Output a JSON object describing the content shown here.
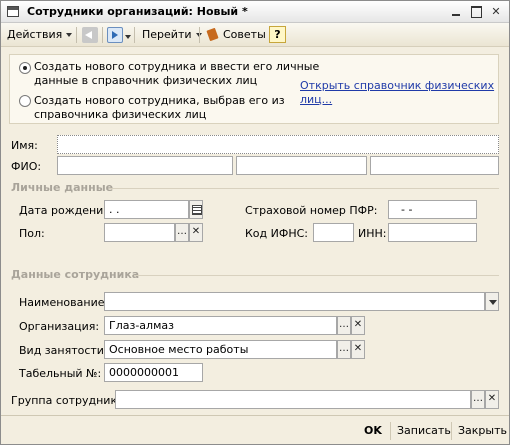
{
  "window": {
    "title": "Сотрудники организаций: Новый *"
  },
  "toolbar": {
    "actions_label": "Действия",
    "goto_label": "Перейти",
    "tips_label": "Советы",
    "help_label": "?"
  },
  "options": {
    "option1_line1": "Создать нового сотрудника и ввести его личные",
    "option1_line2": "данные в справочник физических лиц",
    "option2_line1": "Создать нового сотрудника, выбрав его из",
    "option2_line2": "справочника физических лиц",
    "link_line1": "Открыть справочник физических",
    "link_line2": "лиц..."
  },
  "form": {
    "name_label": "Имя:",
    "name_value": "",
    "fio_label": "ФИО:",
    "personal_section": "Личные данные",
    "birth_label": "Дата рождения:",
    "birth_value": " .  .",
    "gender_label": "Пол:",
    "gender_value": "",
    "pfr_label": "Страховой номер ПФР:",
    "pfr_value": "-   -",
    "ifns_label": "Код ИФНС:",
    "ifns_value": "",
    "inn_label": "ИНН:",
    "inn_value": "",
    "employee_section": "Данные сотрудника",
    "title_label": "Наименование:",
    "title_value": "",
    "org_label": "Организация:",
    "org_value": "Глаз-алмаз",
    "employment_label": "Вид занятости:",
    "employment_value": "Основное место работы",
    "tab_label": "Табельный №:",
    "tab_value": "0000000001",
    "group_label": "Группа сотрудника:",
    "group_value": ""
  },
  "footer": {
    "ok_label": "OK",
    "save_label": "Записать",
    "close_label": "Закрыть"
  },
  "icons": {
    "window": "form-window-icon",
    "minimize": "minimize-icon",
    "maximize": "maximize-icon",
    "close": "close-icon",
    "back": "back-arrow-icon",
    "navigate": "navigate-icon",
    "tips": "book-icon",
    "calendar": "calendar-icon",
    "select": "ellipsis-icon",
    "clear": "clear-x-icon",
    "dropdown": "chevron-down-icon"
  }
}
